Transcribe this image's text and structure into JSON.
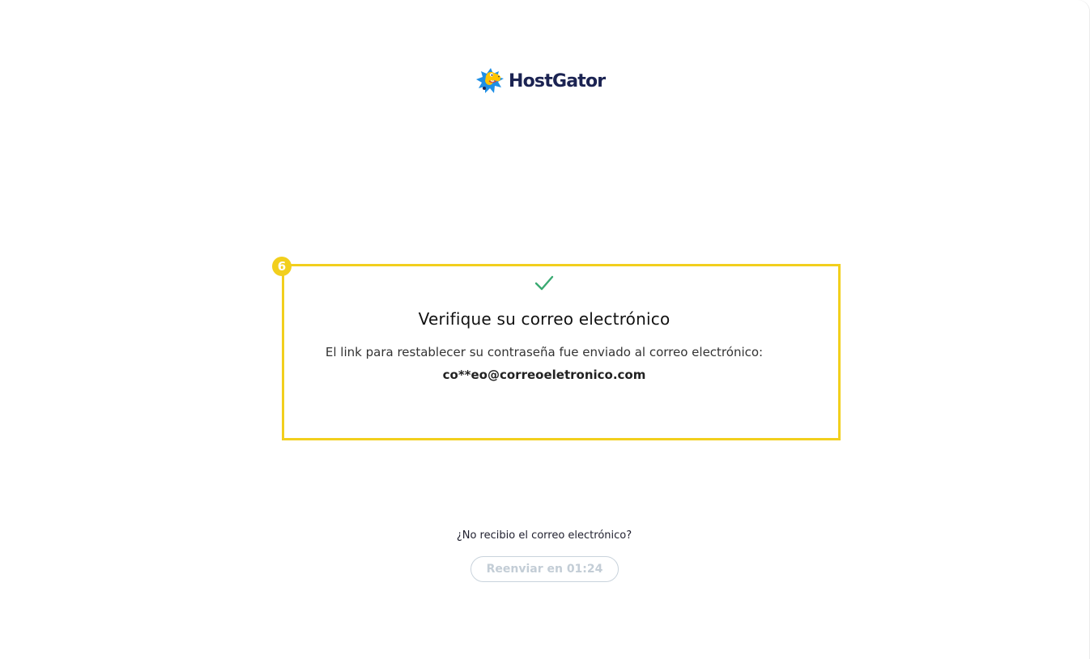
{
  "brand": {
    "name": "HostGator",
    "logo_icon": "gator-mascot-icon",
    "text_color": "#1b2352"
  },
  "annotation": {
    "step_number": "6",
    "color": "#f2cf1d"
  },
  "verification": {
    "status_icon": "check-icon",
    "status_color": "#3aaa72",
    "title": "Verifique su correo electrónico",
    "message": "El link para restablecer su contraseña fue enviado al correo electrónico:",
    "email": "co**eo@correoeletronico.com"
  },
  "resend": {
    "question": "¿No recibio el correo electrónico?",
    "button_label": "Reenviar en 01:24",
    "button_disabled": true
  }
}
